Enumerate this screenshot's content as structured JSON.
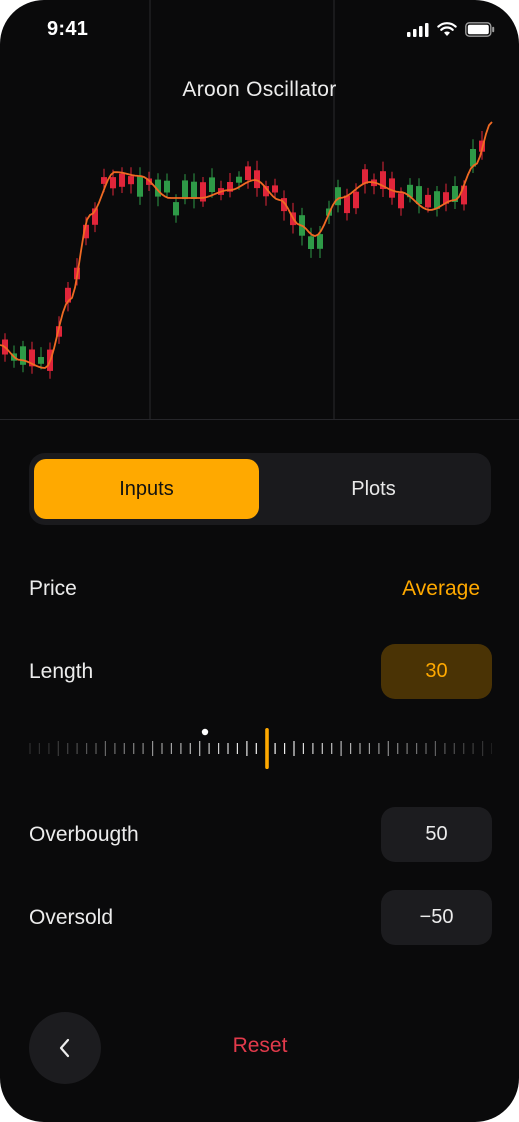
{
  "status_bar": {
    "time": "9:41",
    "icons": [
      "cellular-signal-icon",
      "wifi-icon",
      "battery-icon"
    ]
  },
  "chart": {
    "title": "Aroon Oscillator",
    "colors": {
      "up": "#2e9a47",
      "down": "#e0253a",
      "line": "#f06a23",
      "grid": "#2a2a2e"
    }
  },
  "tabs": [
    {
      "label": "Inputs",
      "active": true
    },
    {
      "label": "Plots",
      "active": false
    }
  ],
  "inputs": {
    "price": {
      "label": "Price",
      "value": "Average"
    },
    "length": {
      "label": "Length",
      "value": "30"
    },
    "overbought": {
      "label": "Overbougth",
      "value": "50"
    },
    "oversold": {
      "label": "Oversold",
      "value": "−50"
    }
  },
  "footer": {
    "back_icon": "chevron-left-icon",
    "reset_label": "Reset"
  },
  "colors": {
    "accent": "#ffa900",
    "danger": "#e23a4b",
    "background": "#0a0a0b"
  }
}
